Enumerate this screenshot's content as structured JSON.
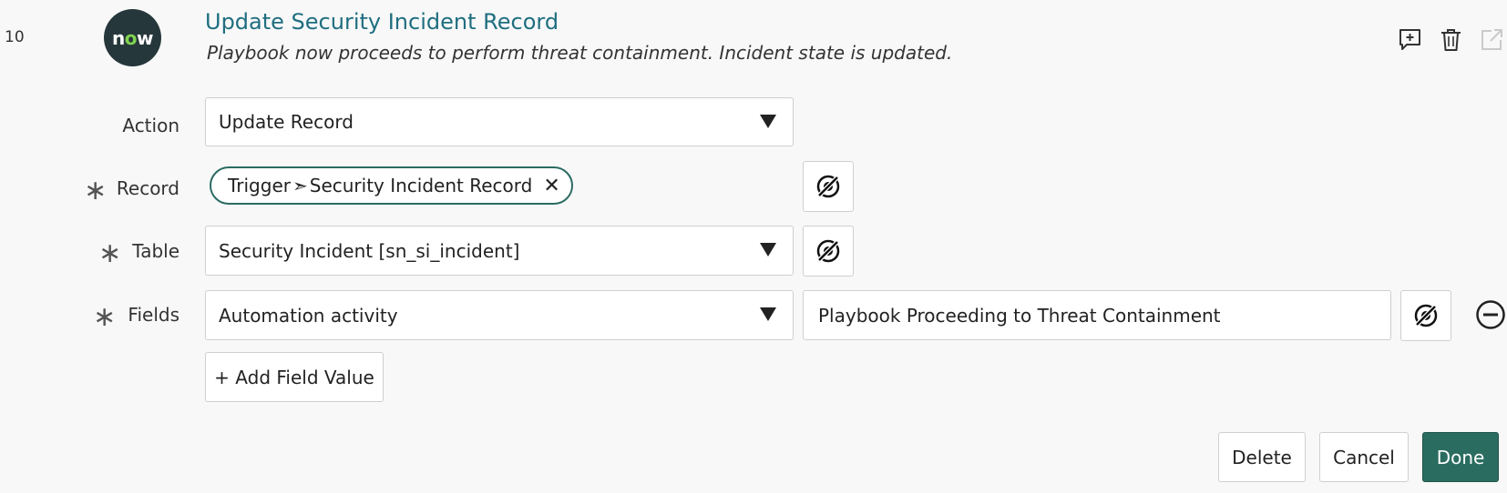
{
  "step": {
    "number": "10",
    "logo_text_parts": [
      "n",
      "o",
      "w"
    ],
    "title": "Update Security Incident Record",
    "subtitle": "Playbook now proceeds to perform threat containment. Incident state is updated."
  },
  "header_icons": [
    "add-comment-icon",
    "trash-icon",
    "open-external-icon"
  ],
  "form": {
    "action": {
      "label": "Action",
      "value": "Update Record"
    },
    "record": {
      "label": "Record",
      "pill_left": "Trigger",
      "pill_right": "Security Incident Record",
      "pill_arrow": "➣",
      "pill_close": "✕"
    },
    "table": {
      "label": "Table",
      "value": "Security Incident [sn_si_incident]"
    },
    "fields": {
      "label": "Fields",
      "field": "Automation activity",
      "value": "Playbook Proceeding to Threat Containment"
    },
    "add_field_label": "+ Add Field Value",
    "required_marker": "∗"
  },
  "footer": {
    "delete_label": "Delete",
    "cancel_label": "Cancel",
    "done_label": "Done"
  },
  "colors": {
    "title": "#1f6e80",
    "primary_button": "#2a6d60",
    "pill_border": "#2b6b62",
    "logo_bg": "#26373b"
  }
}
